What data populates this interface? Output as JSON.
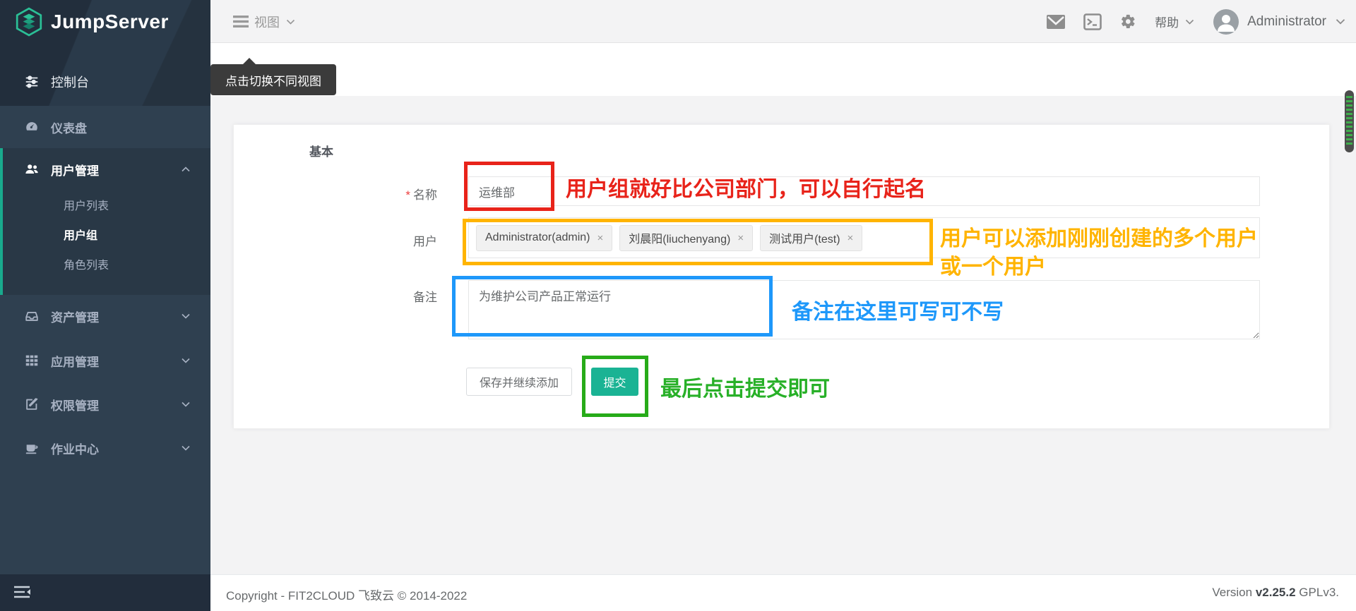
{
  "brand": {
    "name": "JumpServer"
  },
  "sidebar": {
    "console": "控制台",
    "dashboard": "仪表盘",
    "user_mgmt": "用户管理",
    "user_list": "用户列表",
    "user_group": "用户组",
    "role_list": "角色列表",
    "asset_mgmt": "资产管理",
    "app_mgmt": "应用管理",
    "perm_mgmt": "权限管理",
    "job_center": "作业中心"
  },
  "topbar": {
    "view_label": "视图",
    "view_tooltip": "点击切换不同视图",
    "help_label": "帮助",
    "username": "Administrator"
  },
  "form": {
    "section_title": "基本",
    "required_marker": "*",
    "name_label": "名称",
    "name_value": "运维部",
    "users_label": "用户",
    "user_tags": [
      "Administrator(admin)",
      "刘晨阳(liuchenyang)",
      "测试用户(test)"
    ],
    "tag_remove_glyph": "×",
    "comment_label": "备注",
    "comment_value": "为维护公司产品正常运行",
    "save_continue_label": "保存并继续添加",
    "submit_label": "提交"
  },
  "annotations": {
    "name_note": "用户组就好比公司部门，可以自行起名",
    "users_note_line1": "用户可以添加刚刚创建的多个用户",
    "users_note_line2": "或一个用户",
    "comment_note": "备注在这里可写可不写",
    "submit_note": "最后点击提交即可"
  },
  "footer": {
    "copyright": "Copyright - FIT2CLOUD 飞致云 © 2014-2022",
    "version_label": "Version",
    "version_value": "v2.25.2",
    "license": "GPLv3."
  },
  "colors": {
    "accent": "#1ab394",
    "annotation_red": "#e8231a",
    "annotation_orange": "#ffb400",
    "annotation_blue": "#1e98fa",
    "annotation_green": "#28b028"
  }
}
